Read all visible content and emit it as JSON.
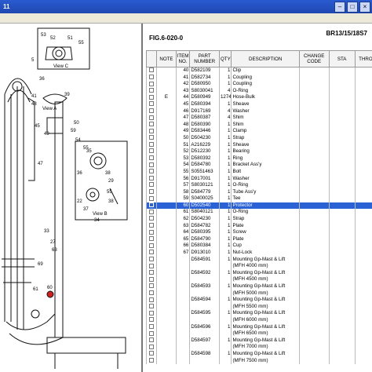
{
  "window": {
    "title": "11"
  },
  "figure": {
    "number": "FIG.6-020-0",
    "models": "BR13/15/18S7"
  },
  "drawing": {
    "views": [
      "View C",
      "View A",
      "View B"
    ],
    "callouts": [
      "53",
      "52",
      "51",
      "55",
      "5",
      "36",
      "41",
      "48",
      "39",
      "45",
      "49",
      "50",
      "59",
      "54",
      "55",
      "47",
      "35",
      "36",
      "38",
      "29",
      "55",
      "22",
      "38",
      "37",
      "34",
      "33",
      "27",
      "63",
      "69",
      "60",
      "61"
    ]
  },
  "table": {
    "headers": [
      "",
      "NOTE",
      "ITEM NO.",
      "PART NUMBER",
      "QTY",
      "DESCRIPTION",
      "CHANGE CODE",
      "STA",
      "THROW"
    ],
    "rows": [
      {
        "note": "",
        "item": "40",
        "part": "D582109",
        "qty": "1",
        "desc": "Clip"
      },
      {
        "note": "",
        "item": "41",
        "part": "D582734",
        "qty": "1",
        "desc": "Coupling"
      },
      {
        "note": "",
        "item": "42",
        "part": "D580950",
        "qty": "1",
        "desc": "Coupling"
      },
      {
        "note": "",
        "item": "43",
        "part": "S8030041",
        "qty": "4",
        "desc": "O-Ring"
      },
      {
        "note": "E",
        "item": "44",
        "part": "D580949",
        "qty": "1274",
        "desc": "Hose-Bulk"
      },
      {
        "note": "",
        "item": "45",
        "part": "D580394",
        "qty": "1",
        "desc": "Sheave"
      },
      {
        "note": "",
        "item": "46",
        "part": "D917169",
        "qty": "4",
        "desc": "Washer"
      },
      {
        "note": "",
        "item": "47",
        "part": "D580387",
        "qty": "4",
        "desc": "Shim"
      },
      {
        "note": "",
        "item": "48",
        "part": "D580390",
        "qty": "1",
        "desc": "Shim"
      },
      {
        "note": "",
        "item": "49",
        "part": "D583446",
        "qty": "1",
        "desc": "Clamp"
      },
      {
        "note": "",
        "item": "50",
        "part": "D504230",
        "qty": "1",
        "desc": "Strap"
      },
      {
        "note": "",
        "item": "51",
        "part": "A216229",
        "qty": "1",
        "desc": "Sheave"
      },
      {
        "note": "",
        "item": "52",
        "part": "D512230",
        "qty": "1",
        "desc": "Bearing"
      },
      {
        "note": "",
        "item": "53",
        "part": "D580392",
        "qty": "1",
        "desc": "Ring"
      },
      {
        "note": "",
        "item": "54",
        "part": "D584780",
        "qty": "1",
        "desc": "Bracket Ass'y"
      },
      {
        "note": "",
        "item": "55",
        "part": "S0551463",
        "qty": "1",
        "desc": "Bolt"
      },
      {
        "note": "",
        "item": "56",
        "part": "D917001",
        "qty": "1",
        "desc": "Washer"
      },
      {
        "note": "",
        "item": "57",
        "part": "S8030121",
        "qty": "1",
        "desc": "O-Ring"
      },
      {
        "note": "",
        "item": "58",
        "part": "D584779",
        "qty": "1",
        "desc": "Tube Ass'y"
      },
      {
        "note": "",
        "item": "59",
        "part": "S0400025",
        "qty": "1",
        "desc": "Tee"
      },
      {
        "note": "",
        "item": "60",
        "part": "D502540",
        "qty": "1",
        "desc": "Protector",
        "selected": true
      },
      {
        "note": "",
        "item": "61",
        "part": "S8040121",
        "qty": "1",
        "desc": "O-Ring"
      },
      {
        "note": "",
        "item": "62",
        "part": "D504230",
        "qty": "1",
        "desc": "Strap"
      },
      {
        "note": "",
        "item": "63",
        "part": "D584782",
        "qty": "1",
        "desc": "Plate"
      },
      {
        "note": "",
        "item": "64",
        "part": "D580395",
        "qty": "1",
        "desc": "Screw"
      },
      {
        "note": "",
        "item": "65",
        "part": "D584790",
        "qty": "1",
        "desc": "Plate"
      },
      {
        "note": "",
        "item": "66",
        "part": "D580384",
        "qty": "1",
        "desc": "Cup"
      },
      {
        "note": "",
        "item": "67",
        "part": "D913010",
        "qty": "1",
        "desc": "Nut-Lock"
      },
      {
        "note": "",
        "item": "",
        "part": "D584591",
        "qty": "1",
        "desc": "Mounting Gp-Mast & Lift"
      },
      {
        "note": "",
        "item": "",
        "part": "",
        "qty": "",
        "desc": "(MFH 4000 mm)"
      },
      {
        "note": "",
        "item": "",
        "part": "D584592",
        "qty": "1",
        "desc": "Mounting Gp-Mast & Lift"
      },
      {
        "note": "",
        "item": "",
        "part": "",
        "qty": "",
        "desc": "(MFH 4500 mm)"
      },
      {
        "note": "",
        "item": "",
        "part": "D584593",
        "qty": "1",
        "desc": "Mounting Gp-Mast & Lift"
      },
      {
        "note": "",
        "item": "",
        "part": "",
        "qty": "",
        "desc": "(MFH 5000 mm)"
      },
      {
        "note": "",
        "item": "",
        "part": "D584594",
        "qty": "1",
        "desc": "Mounting Gp-Mast & Lift"
      },
      {
        "note": "",
        "item": "",
        "part": "",
        "qty": "",
        "desc": "(MFH 5500 mm)"
      },
      {
        "note": "",
        "item": "",
        "part": "D584595",
        "qty": "1",
        "desc": "Mounting Gp-Mast & Lift"
      },
      {
        "note": "",
        "item": "",
        "part": "",
        "qty": "",
        "desc": "(MFH 6000 mm)"
      },
      {
        "note": "",
        "item": "",
        "part": "D584596",
        "qty": "1",
        "desc": "Mounting Gp-Mast & Lift"
      },
      {
        "note": "",
        "item": "",
        "part": "",
        "qty": "",
        "desc": "(MFH 6500 mm)"
      },
      {
        "note": "",
        "item": "",
        "part": "D584597",
        "qty": "1",
        "desc": "Mounting Gp-Mast & Lift"
      },
      {
        "note": "",
        "item": "",
        "part": "",
        "qty": "",
        "desc": "(MFH 7000 mm)"
      },
      {
        "note": "",
        "item": "",
        "part": "D584598",
        "qty": "1",
        "desc": "Mounting Gp-Mast & Lift"
      },
      {
        "note": "",
        "item": "",
        "part": "",
        "qty": "",
        "desc": "(MFH 7500 mm)"
      }
    ]
  },
  "colors": {
    "titlebar": "#2a5bd1",
    "selection": "#2a62d6"
  }
}
